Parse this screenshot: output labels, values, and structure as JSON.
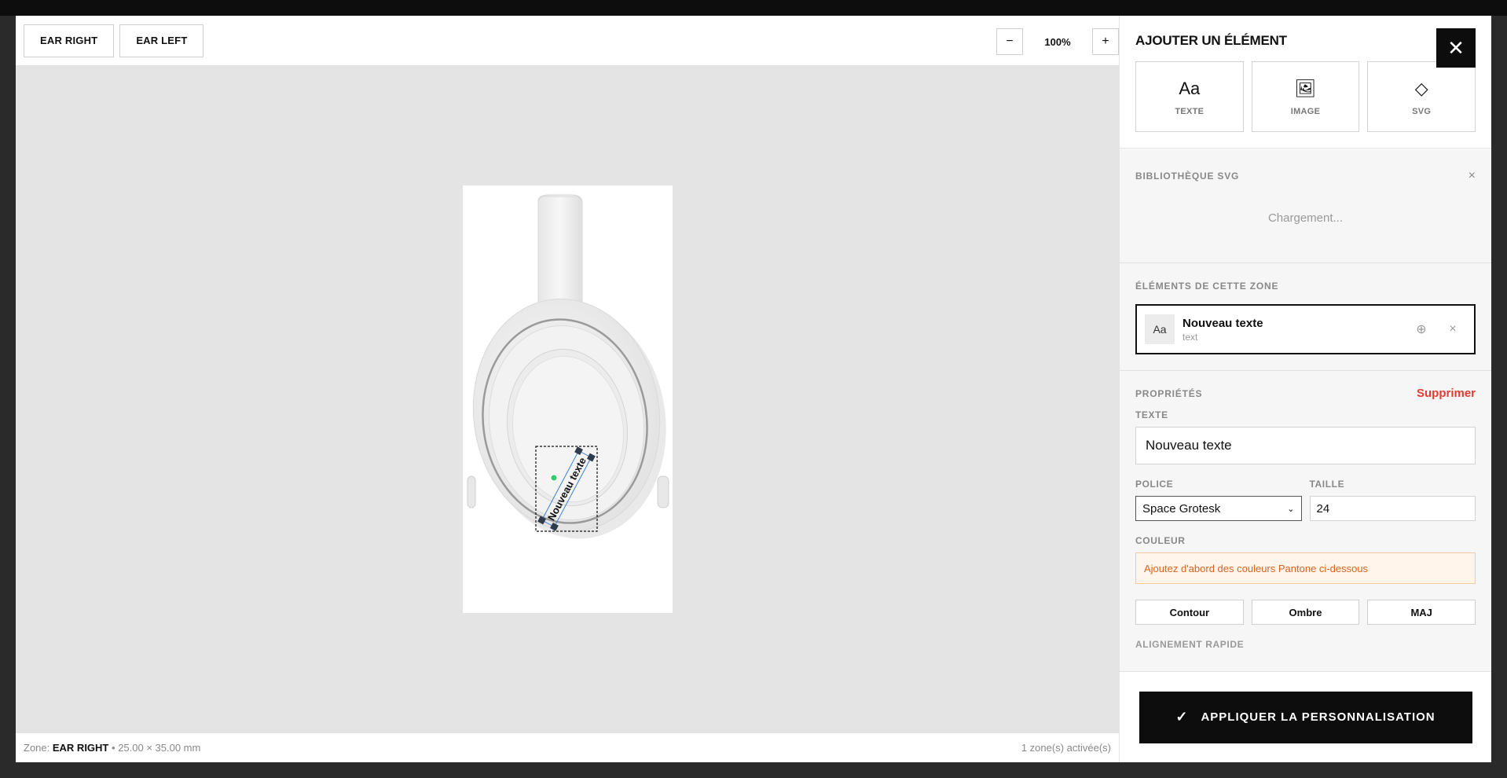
{
  "zones": {
    "tabs": [
      {
        "label": "EAR RIGHT"
      },
      {
        "label": "EAR LEFT"
      }
    ]
  },
  "zoom": {
    "minus": "−",
    "value": "100%",
    "plus": "+"
  },
  "canvas": {
    "text_element": "Nouveau texte",
    "colors": {
      "stage": "#e4e4e4",
      "selection": "#3b7fd8",
      "handle": "#2f3b4a",
      "rotate_handle": "#2ecc71"
    }
  },
  "footer": {
    "zone_prefix": "Zone:",
    "zone_name": "EAR RIGHT",
    "sep": "•",
    "dimensions": "25.00 × 35.00 mm",
    "active_count": "1 zone(s) activée(s)"
  },
  "panel": {
    "close_icon": "✕",
    "add_title": "AJOUTER UN ÉLÉMENT",
    "add_items": [
      {
        "icon": "Aa",
        "label": "TEXTE"
      },
      {
        "icon": "🖼",
        "label": "IMAGE"
      },
      {
        "icon": "◇",
        "label": "SVG"
      }
    ],
    "svg_library": {
      "title": "BIBLIOTHÈQUE SVG",
      "close": "×",
      "loading": "Chargement..."
    },
    "zone_elements": {
      "title": "ÉLÉMENTS DE CETTE ZONE",
      "items": [
        {
          "thumb": "Aa",
          "name": "Nouveau texte",
          "type": "text",
          "center_icon": "⊕",
          "remove_icon": "×"
        }
      ]
    },
    "properties": {
      "title": "PROPRIÉTÉS",
      "delete_label": "Supprimer",
      "text_label": "TEXTE",
      "text_value": "Nouveau texte",
      "font_label": "POLICE",
      "font_value": "Space Grotesk",
      "size_label": "TAILLE",
      "size_value": "24",
      "color_label": "COULEUR",
      "color_warning": "Ajoutez d'abord des couleurs Pantone ci-dessous",
      "style_buttons": [
        "Contour",
        "Ombre",
        "MAJ"
      ],
      "align_label": "ALIGNEMENT RAPIDE"
    },
    "apply": {
      "icon": "✓",
      "label": "APPLIQUER LA PERSONNALISATION"
    },
    "colors": {
      "danger": "#e53935",
      "warning_text": "#d9631f",
      "primary": "#0d0d0d"
    }
  }
}
